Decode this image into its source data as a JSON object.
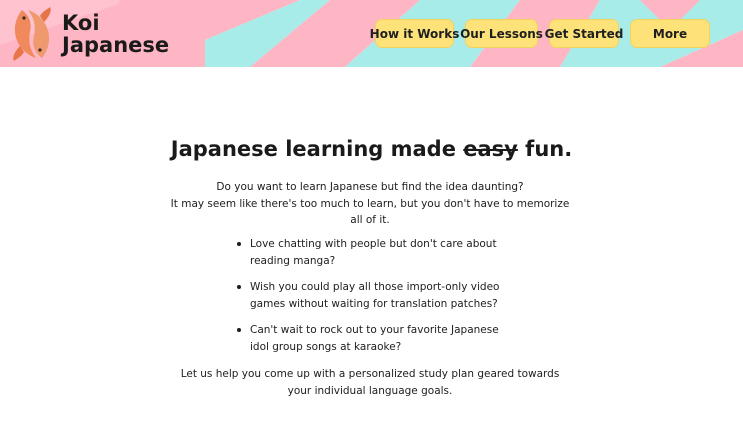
{
  "logo": {
    "line1": "Koi",
    "line2": "Japanese"
  },
  "nav": {
    "how_it_works": "How it Works",
    "our_lessons": "Our Lessons",
    "get_started": "Get Started",
    "more": "More"
  },
  "hero": {
    "headline_before": "Japanese learning made ",
    "headline_struck": "easy",
    "headline_after": " fun.",
    "intro_line1": "Do you want to learn Japanese but find the idea daunting?",
    "intro_line2": "It may seem like there's too much to learn, but you don't have to memorize all of it.",
    "bullets": [
      "Love chatting with people but don't care about reading manga?",
      "Wish you could play all those import-only video games without waiting for translation patches?",
      "Can't wait to rock out to your favorite Japanese idol group songs at karaoke?"
    ],
    "cta": "Let us help you come up with a personalized study plan geared towards your individual language goals."
  },
  "colors": {
    "pink": "#ffb6c4",
    "cyan": "#a7ece9",
    "button": "#fde27a",
    "koi": "#f08a5d"
  },
  "icons": {
    "logo": "koi-fish-icon"
  }
}
